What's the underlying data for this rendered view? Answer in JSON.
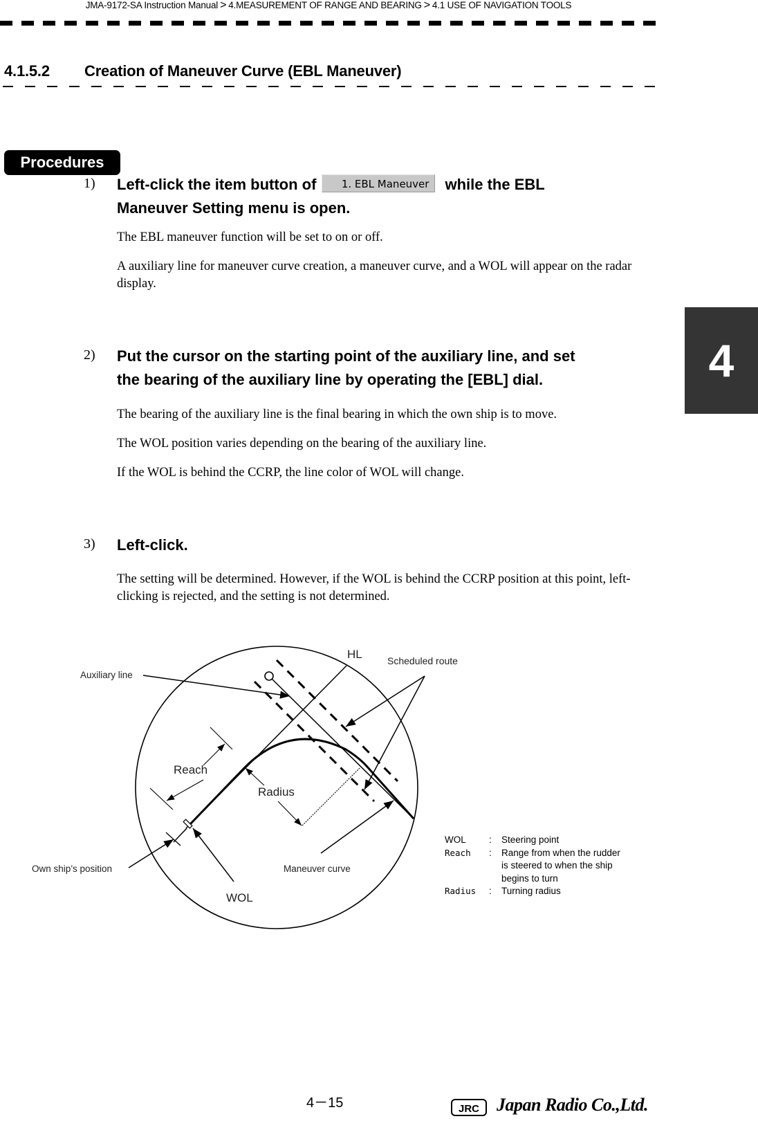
{
  "header": {
    "breadcrumb": [
      "JMA-9172-SA Instruction Manual",
      "4.MEASUREMENT OF RANGE AND BEARING",
      "4.1  USE OF NAVIGATION TOOLS"
    ],
    "separator": ">"
  },
  "section": {
    "number": "4.1.5.2",
    "title": "Creation of Maneuver Curve (EBL Maneuver)"
  },
  "procedures_label": "Procedures",
  "chapter_tab": "4",
  "steps": [
    {
      "number": "1)",
      "heading_before": "Left-click the item button of",
      "button_label": "1. EBL Maneuver",
      "heading_after": "while the EBL",
      "heading_line2": "Maneuver Setting menu is open.",
      "paragraphs": [
        "The EBL maneuver function will be set to on or off.",
        "A auxiliary line for maneuver curve creation, a maneuver curve, and a WOL will appear on the radar display."
      ]
    },
    {
      "number": "2)",
      "heading_line1": "Put the cursor on the starting point of the auxiliary line, and set",
      "heading_line2": "the bearing of the auxiliary line by operating the [EBL] dial.",
      "paragraphs": [
        "The bearing of the auxiliary line is the final bearing in which the own ship is to move.",
        "The WOL position varies depending on the bearing of the auxiliary line.",
        "If the WOL is behind the CCRP, the line color of WOL will change."
      ]
    },
    {
      "number": "3)",
      "heading_line1": "Left-click.",
      "paragraphs": [
        "The setting will be determined. However, if the WOL is behind the CCRP position at this point, left-clicking is rejected, and the setting is not determined."
      ]
    }
  ],
  "diagram": {
    "labels": {
      "hl": "HL",
      "scheduled_route": "Scheduled route",
      "auxiliary_line": "Auxiliary line",
      "reach": "Reach",
      "radius": "Radius",
      "own_ship_position": "Own ship’s position",
      "maneuver_curve": "Maneuver curve",
      "wol": "WOL"
    },
    "legend": [
      {
        "term": "WOL",
        "sep": ":",
        "desc": [
          "Steering point"
        ]
      },
      {
        "term": "Reach",
        "sep": ":",
        "desc": [
          "Range from when the rudder",
          "is steered to when the ship",
          "begins to turn"
        ]
      },
      {
        "term": "Radius",
        "sep": ":",
        "desc": [
          "Turning radius"
        ]
      }
    ]
  },
  "footer": {
    "page_number": "4－15",
    "logo_box": "JRC",
    "company": "Japan Radio Co.,Ltd."
  }
}
